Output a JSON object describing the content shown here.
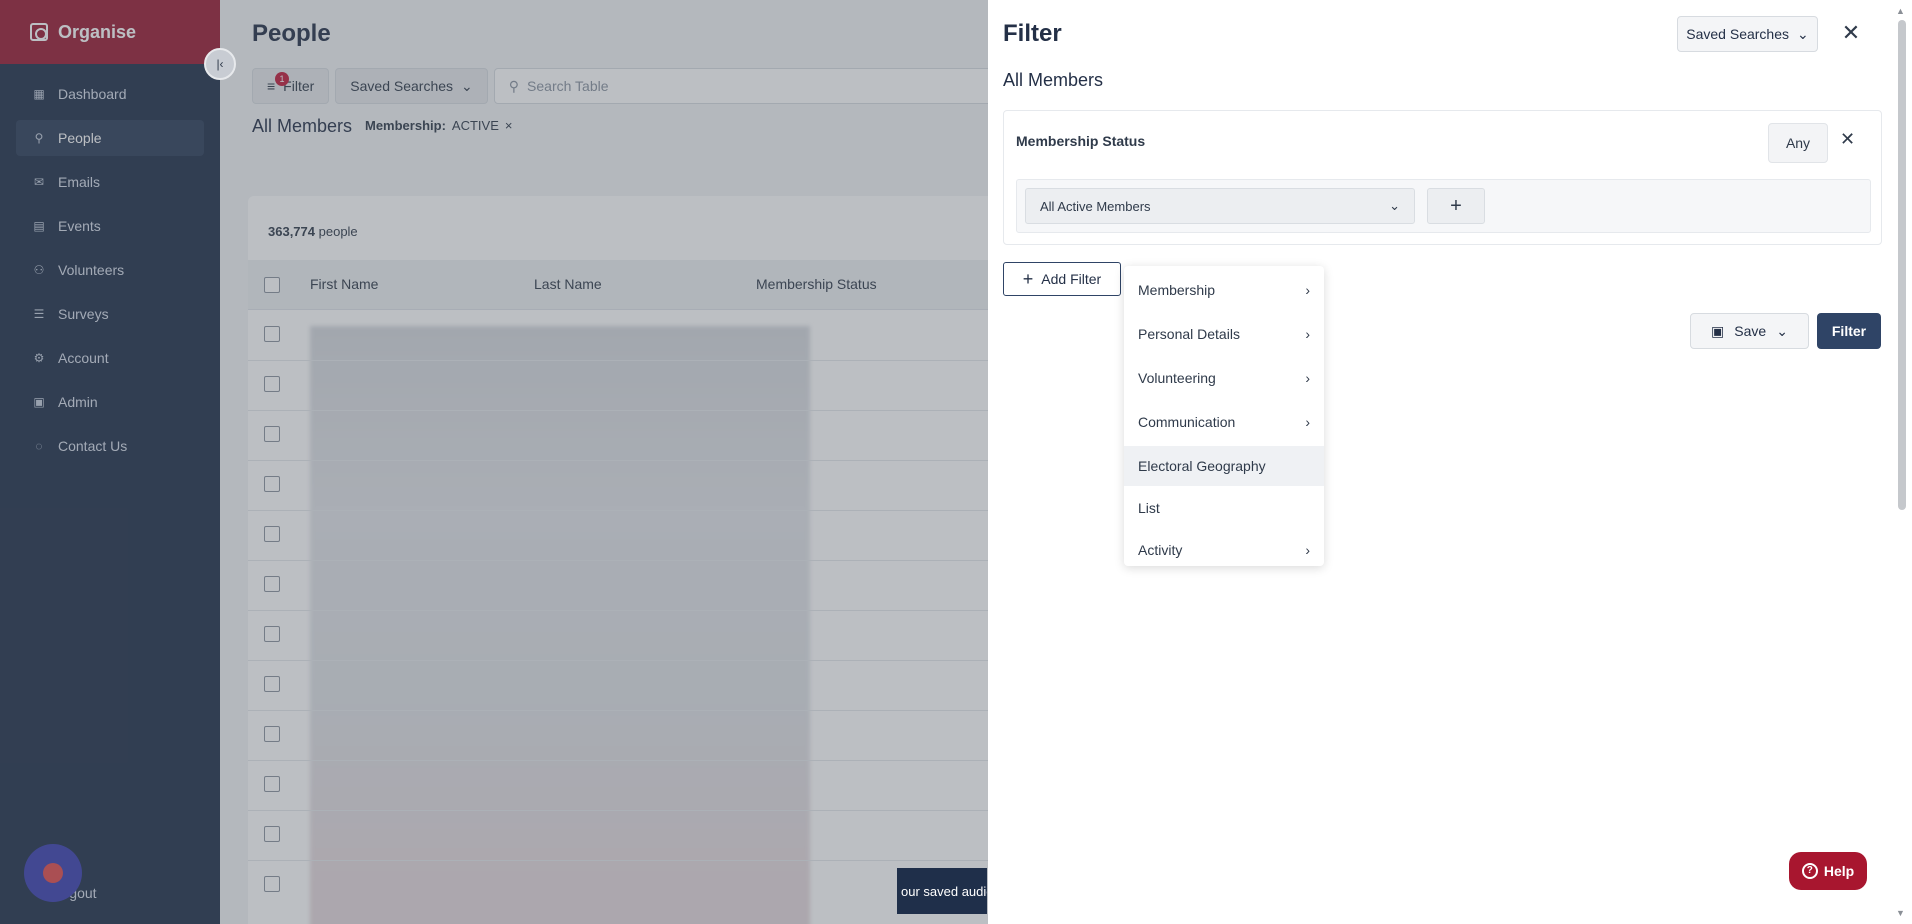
{
  "app": {
    "name": "Organise"
  },
  "sidebar": {
    "items": [
      {
        "label": "Dashboard",
        "icon": "grid-icon"
      },
      {
        "label": "People",
        "icon": "person-icon",
        "active": true
      },
      {
        "label": "Emails",
        "icon": "mail-icon"
      },
      {
        "label": "Events",
        "icon": "calendar-icon"
      },
      {
        "label": "Volunteers",
        "icon": "group-icon"
      },
      {
        "label": "Surveys",
        "icon": "survey-icon"
      },
      {
        "label": "Account",
        "icon": "gear-icon"
      },
      {
        "label": "Admin",
        "icon": "lock-icon"
      },
      {
        "label": "Contact Us",
        "icon": "chat-icon"
      }
    ],
    "logout_label": "Logout"
  },
  "main": {
    "title": "People",
    "filter_label": "Filter",
    "filter_badge": "1",
    "saved_searches_label": "Saved Searches",
    "search_placeholder": "Search Table",
    "segment_title": "All Members",
    "chip_key": "Membership:",
    "chip_value": "ACTIVE",
    "count_number": "363,774",
    "count_suffix": "people",
    "columns": [
      "First Name",
      "Last Name",
      "Membership Status"
    ],
    "toast_text": "our saved audie"
  },
  "filter_panel": {
    "title": "Filter",
    "saved_searches_label": "Saved Searches",
    "subtitle": "All Members",
    "group_label": "Membership Status",
    "any_label": "Any",
    "select_value": "All Active Members",
    "add_filter_label": "Add Filter",
    "save_label": "Save",
    "filter_label": "Filter",
    "help_label": "Help",
    "dropdown_items": [
      {
        "label": "Membership",
        "submenu": true
      },
      {
        "label": "Personal Details",
        "submenu": true
      },
      {
        "label": "Volunteering",
        "submenu": true
      },
      {
        "label": "Communication",
        "submenu": true
      },
      {
        "label": "Electoral Geography",
        "submenu": false,
        "hover": true
      },
      {
        "label": "List",
        "submenu": false
      },
      {
        "label": "Activity",
        "submenu": true
      }
    ]
  },
  "colors": {
    "brand": "#9a1b33",
    "sidebar": "#1f2f4a",
    "primary_button": "#2f4466",
    "help": "#a8162f"
  }
}
